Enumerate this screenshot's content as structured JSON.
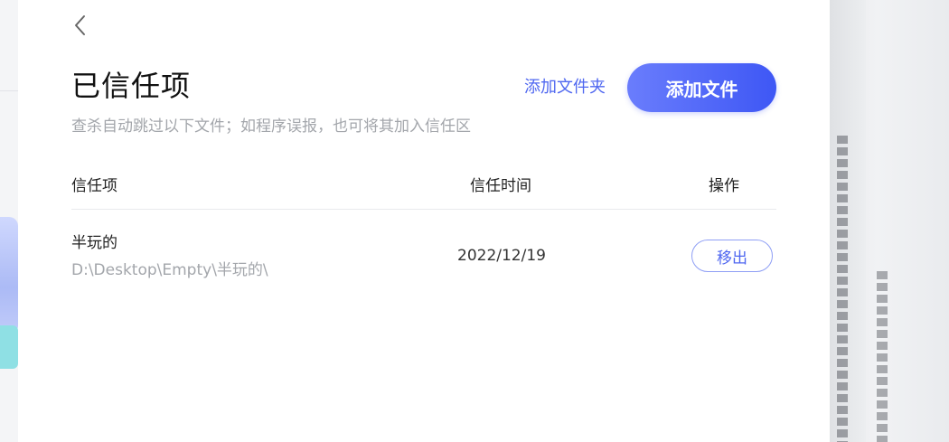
{
  "header": {
    "back_icon": "chevron-left-icon",
    "title": "已信任项",
    "subtitle": "查杀自动跳过以下文件；如程序误报，也可将其加入信任区",
    "add_folder_label": "添加文件夹",
    "add_file_label": "添加文件"
  },
  "table": {
    "columns": [
      "信任项",
      "信任时间",
      "操作"
    ],
    "rows": [
      {
        "name": "半玩的",
        "path": "D:\\Desktop\\Empty\\半玩的\\",
        "time": "2022/12/19",
        "action_label": "移出"
      }
    ]
  },
  "colors": {
    "accent": "#4f67f0",
    "button_gradient_start": "#6a7dfc",
    "button_gradient_end": "#3e57f5",
    "muted_text": "#a3a6ab"
  }
}
